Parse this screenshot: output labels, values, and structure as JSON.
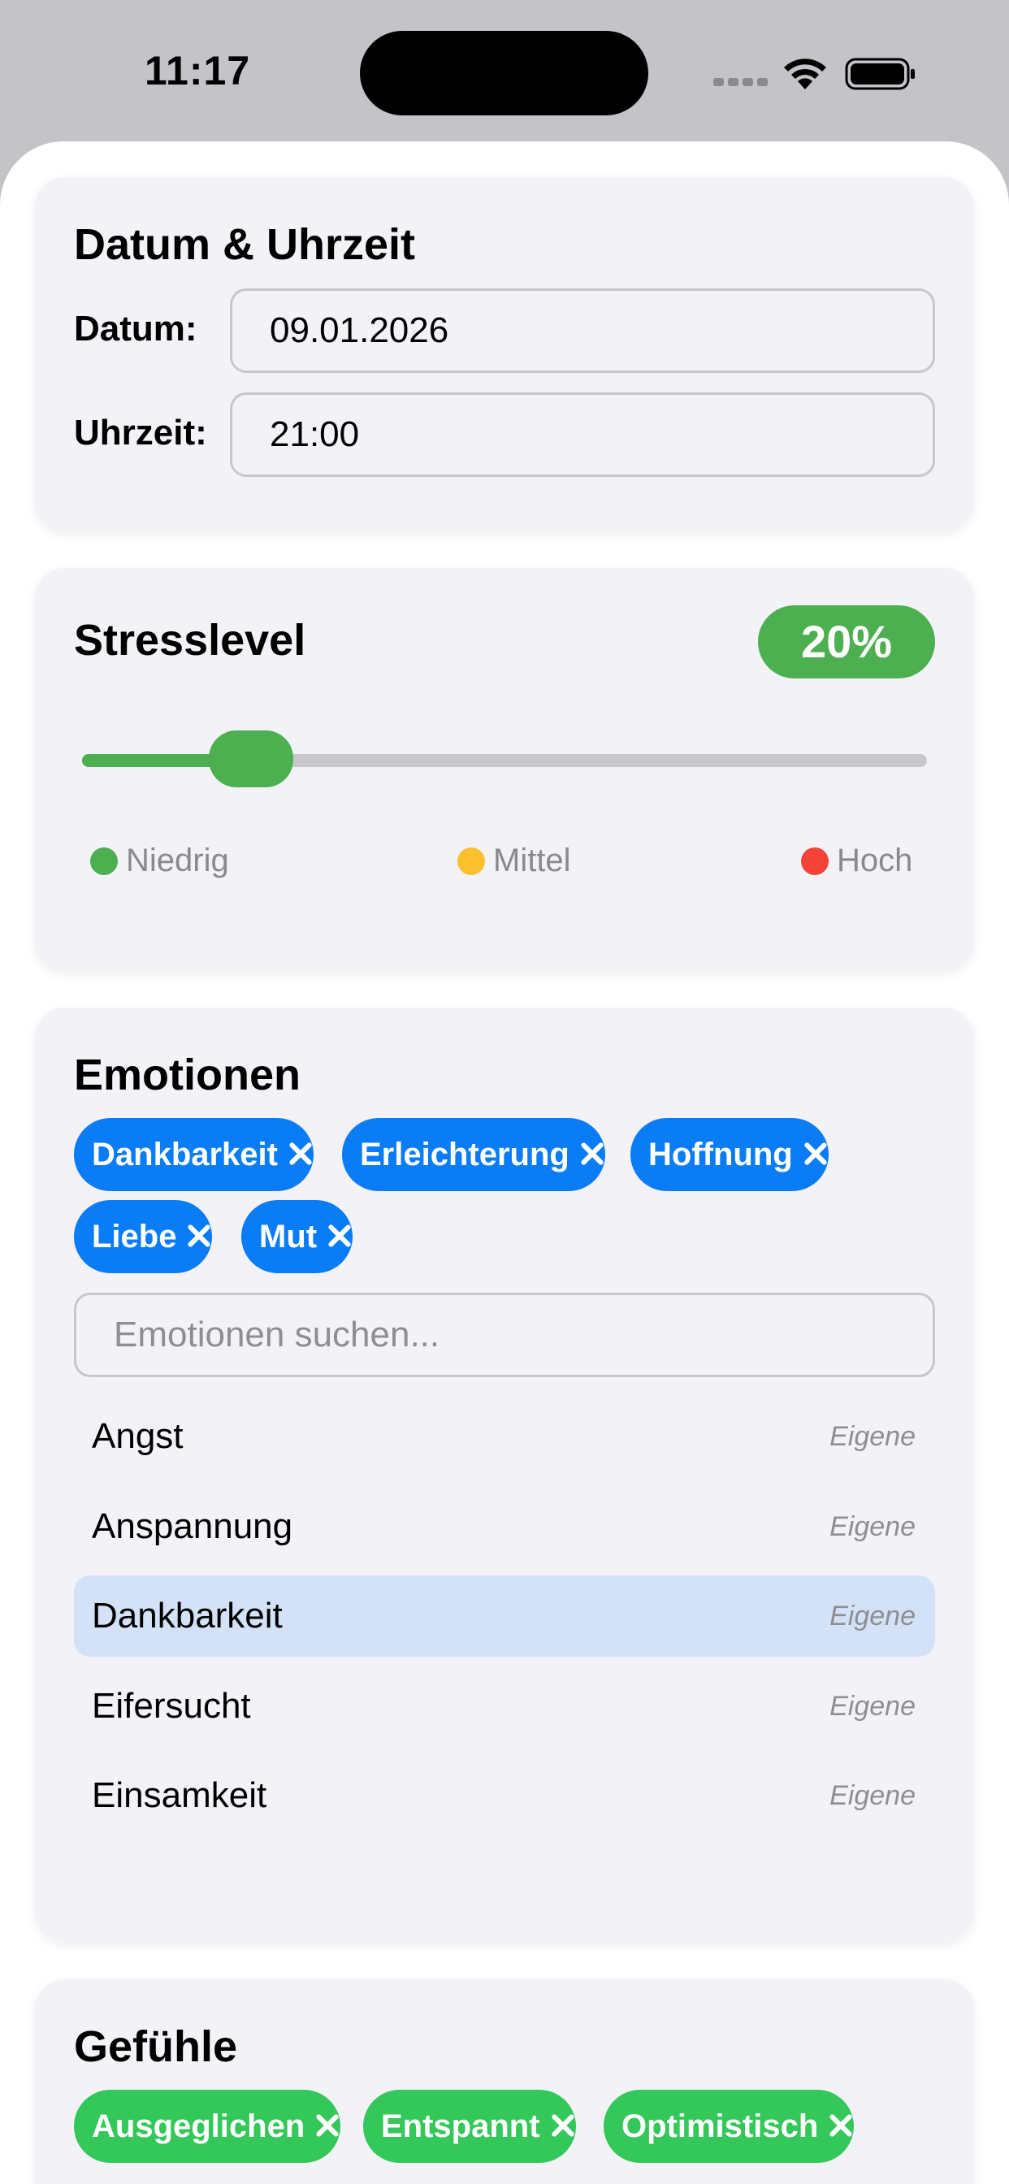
{
  "status_bar": {
    "time": "11:17"
  },
  "date_card": {
    "title": "Datum & Uhrzeit",
    "date_label": "Datum:",
    "date_value": "09.01.2026",
    "time_label": "Uhrzeit:",
    "time_value": "21:00"
  },
  "stress_card": {
    "title": "Stresslevel",
    "badge": "20%",
    "level_fraction": 0.2,
    "legend": [
      {
        "label": "Niedrig",
        "color": "#4caf50"
      },
      {
        "label": "Mittel",
        "color": "#fbc02d"
      },
      {
        "label": "Hoch",
        "color": "#f44336"
      }
    ]
  },
  "emotions_card": {
    "title": "Emotionen",
    "chips": [
      "Dankbarkeit",
      "Erleichterung",
      "Hoffnung",
      "Liebe",
      "Mut"
    ],
    "search_placeholder": "Emotionen suchen...",
    "list": [
      {
        "label": "Angst",
        "tag": "Eigene",
        "selected": false
      },
      {
        "label": "Anspannung",
        "tag": "Eigene",
        "selected": false
      },
      {
        "label": "Dankbarkeit",
        "tag": "Eigene",
        "selected": true
      },
      {
        "label": "Eifersucht",
        "tag": "Eigene",
        "selected": false
      },
      {
        "label": "Einsamkeit",
        "tag": "Eigene",
        "selected": false
      }
    ]
  },
  "feelings_card": {
    "title": "Gefühle",
    "chips": [
      "Ausgeglichen",
      "Entspannt",
      "Optimistisch"
    ]
  },
  "colors": {
    "accent_blue": "#0a7cf5",
    "accent_green": "#34c759",
    "stress_green": "#4caf50"
  }
}
